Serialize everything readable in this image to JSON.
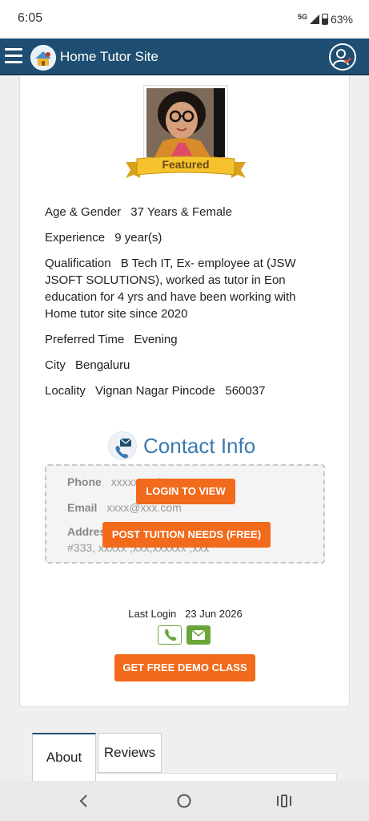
{
  "status": {
    "time": "6:05",
    "network": "5G",
    "battery": "63%"
  },
  "header": {
    "title": "Home Tutor Site"
  },
  "profile": {
    "badge": "Featured",
    "details": [
      {
        "label": "Age & Gender",
        "value": "37 Years & Female"
      },
      {
        "label": "Experience",
        "value": "9 year(s)"
      },
      {
        "label": "Qualification",
        "value": "B Tech IT, Ex- employee at (JSW JSOFT SOLUTIONS), worked as tutor in Eon education for 4 yrs and have been working with Home tutor site since 2020"
      },
      {
        "label": "Preferred Time",
        "value": "Evening"
      },
      {
        "label": "City",
        "value": "Bengaluru"
      },
      {
        "label": "Locality",
        "value": "Vignan Nagar Pincode   560037"
      }
    ]
  },
  "contact": {
    "title": "Contact Info",
    "phone_label": "Phone",
    "phone_value": "xxxxxxxx89",
    "email_label": "Email",
    "email_value": "xxxx@xxx.com",
    "address_label": "Address",
    "address_value": "#333, xxxxx ,xxx,xxxxxx ,xxx",
    "login_button": "LOGIN TO VIEW",
    "post_button": "POST TUITION NEEDS (FREE)"
  },
  "activity": {
    "last_login_label": "Last Login",
    "last_login_date": "23 Jun 2026",
    "demo_button": "GET FREE DEMO CLASS"
  },
  "tabs": [
    {
      "label": "About"
    },
    {
      "label": "Reviews"
    }
  ],
  "colors": {
    "header": "#1f4e72",
    "accent": "#f26a1b",
    "contact_title": "#3b7ab0",
    "green": "#6aa53a"
  }
}
